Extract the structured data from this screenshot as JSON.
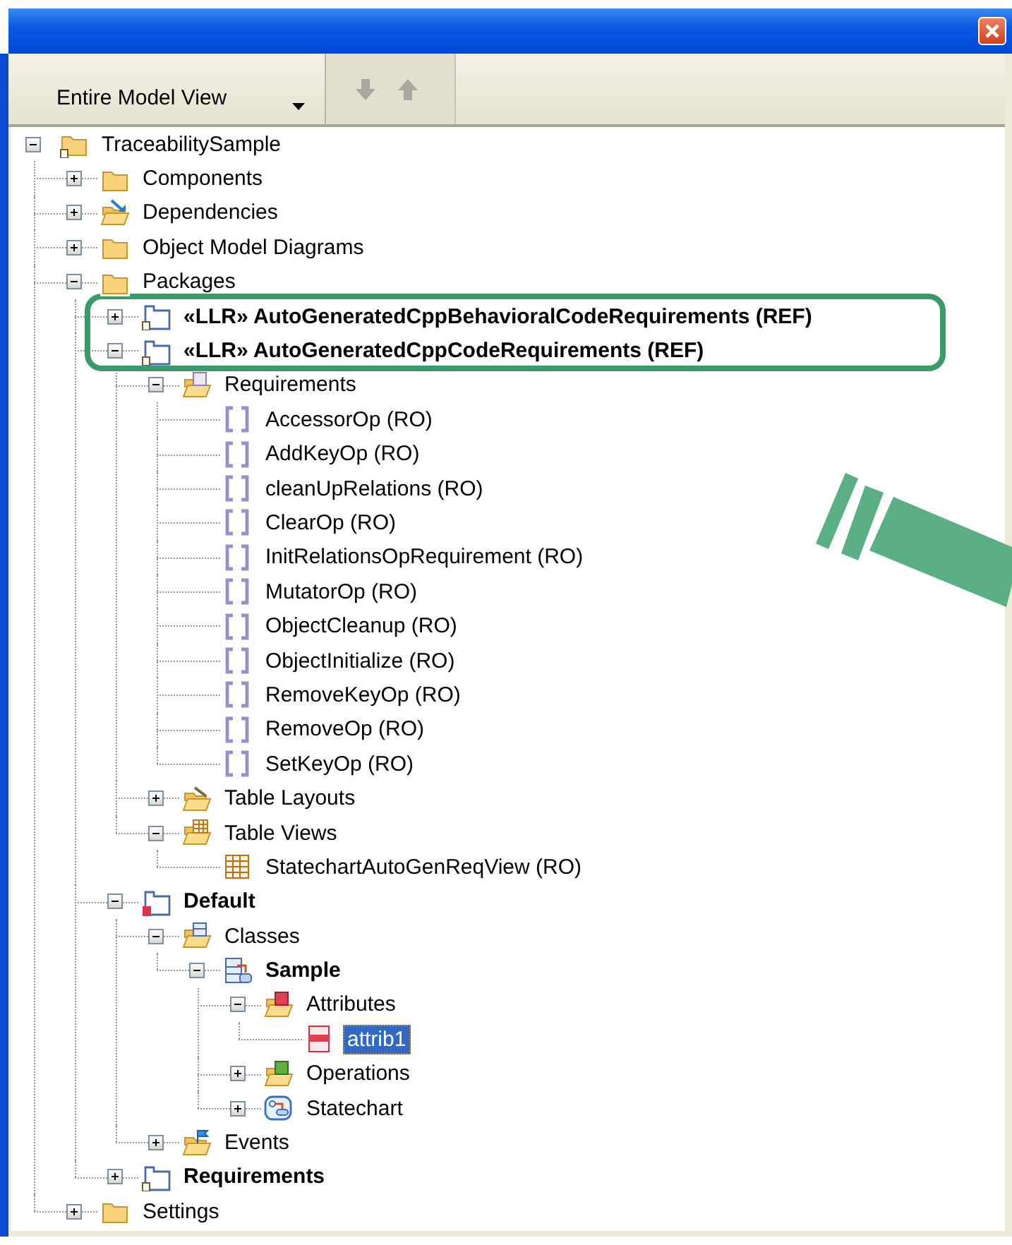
{
  "toolbar": {
    "view_selector": {
      "value": "Entire Model View"
    },
    "buttons": [
      {
        "kind": "down",
        "disabled": true
      },
      {
        "kind": "up",
        "disabled": true
      }
    ]
  },
  "tree": [
    {
      "label": "TraceabilitySample",
      "kind": "project",
      "expandable": true,
      "expanded": true,
      "bold": false,
      "selected": false,
      "children": [
        {
          "label": "Components",
          "kind": "folder",
          "expandable": true,
          "expanded": false,
          "bold": false,
          "selected": false
        },
        {
          "label": "Dependencies",
          "kind": "dependencies",
          "expandable": true,
          "expanded": false,
          "bold": false,
          "selected": false
        },
        {
          "label": "Object Model Diagrams",
          "kind": "folder",
          "expandable": true,
          "expanded": false,
          "bold": false,
          "selected": false
        },
        {
          "label": "Packages",
          "kind": "folder",
          "expandable": true,
          "expanded": true,
          "bold": false,
          "selected": false,
          "children": [
            {
              "label": "«LLR» AutoGeneratedCppBehavioralCodeRequirements (REF)",
              "kind": "ref-package",
              "expandable": true,
              "expanded": false,
              "bold": true,
              "selected": false
            },
            {
              "label": "«LLR» AutoGeneratedCppCodeRequirements (REF)",
              "kind": "ref-package",
              "expandable": true,
              "expanded": true,
              "bold": true,
              "selected": false,
              "children": [
                {
                  "label": "Requirements",
                  "kind": "requirements-folder",
                  "expandable": true,
                  "expanded": true,
                  "bold": false,
                  "selected": false,
                  "children": [
                    {
                      "label": "AccessorOp (RO)",
                      "kind": "requirement",
                      "expandable": false,
                      "bold": false,
                      "selected": false
                    },
                    {
                      "label": "AddKeyOp (RO)",
                      "kind": "requirement",
                      "expandable": false,
                      "bold": false,
                      "selected": false
                    },
                    {
                      "label": "cleanUpRelations (RO)",
                      "kind": "requirement",
                      "expandable": false,
                      "bold": false,
                      "selected": false
                    },
                    {
                      "label": "ClearOp (RO)",
                      "kind": "requirement",
                      "expandable": false,
                      "bold": false,
                      "selected": false
                    },
                    {
                      "label": "InitRelationsOpRequirement (RO)",
                      "kind": "requirement",
                      "expandable": false,
                      "bold": false,
                      "selected": false
                    },
                    {
                      "label": "MutatorOp (RO)",
                      "kind": "requirement",
                      "expandable": false,
                      "bold": false,
                      "selected": false
                    },
                    {
                      "label": "ObjectCleanup (RO)",
                      "kind": "requirement",
                      "expandable": false,
                      "bold": false,
                      "selected": false
                    },
                    {
                      "label": "ObjectInitialize (RO)",
                      "kind": "requirement",
                      "expandable": false,
                      "bold": false,
                      "selected": false
                    },
                    {
                      "label": "RemoveKeyOp (RO)",
                      "kind": "requirement",
                      "expandable": false,
                      "bold": false,
                      "selected": false
                    },
                    {
                      "label": "RemoveOp (RO)",
                      "kind": "requirement",
                      "expandable": false,
                      "bold": false,
                      "selected": false
                    },
                    {
                      "label": "SetKeyOp (RO)",
                      "kind": "requirement",
                      "expandable": false,
                      "bold": false,
                      "selected": false
                    }
                  ]
                },
                {
                  "label": "Table Layouts",
                  "kind": "layouts-folder",
                  "expandable": true,
                  "expanded": false,
                  "bold": false,
                  "selected": false
                },
                {
                  "label": "Table Views",
                  "kind": "views-folder",
                  "expandable": true,
                  "expanded": true,
                  "bold": false,
                  "selected": false,
                  "children": [
                    {
                      "label": "StatechartAutoGenReqView (RO)",
                      "kind": "table-view",
                      "expandable": false,
                      "bold": false,
                      "selected": false
                    }
                  ]
                }
              ]
            },
            {
              "label": "Default",
              "kind": "default-package",
              "expandable": true,
              "expanded": true,
              "bold": true,
              "selected": false,
              "children": [
                {
                  "label": "Classes",
                  "kind": "classes-folder",
                  "expandable": true,
                  "expanded": true,
                  "bold": false,
                  "selected": false,
                  "children": [
                    {
                      "label": "Sample",
                      "kind": "class",
                      "expandable": true,
                      "expanded": true,
                      "bold": true,
                      "selected": false,
                      "children": [
                        {
                          "label": "Attributes",
                          "kind": "attributes-folder",
                          "expandable": true,
                          "expanded": true,
                          "bold": false,
                          "selected": false,
                          "children": [
                            {
                              "label": "attrib1",
                              "kind": "attribute",
                              "expandable": false,
                              "bold": false,
                              "selected": true
                            }
                          ]
                        },
                        {
                          "label": "Operations",
                          "kind": "operations-folder",
                          "expandable": true,
                          "expanded": false,
                          "bold": false,
                          "selected": false
                        },
                        {
                          "label": "Statechart",
                          "kind": "statechart",
                          "expandable": true,
                          "expanded": false,
                          "bold": false,
                          "selected": false
                        }
                      ]
                    }
                  ]
                },
                {
                  "label": "Events",
                  "kind": "events-folder",
                  "expandable": true,
                  "expanded": false,
                  "bold": false,
                  "selected": false
                }
              ]
            },
            {
              "label": "Requirements",
              "kind": "ref-package",
              "expandable": true,
              "expanded": false,
              "bold": true,
              "selected": false
            }
          ]
        },
        {
          "label": "Settings",
          "kind": "folder",
          "expandable": true,
          "expanded": false,
          "bold": false,
          "selected": false
        }
      ]
    }
  ]
}
